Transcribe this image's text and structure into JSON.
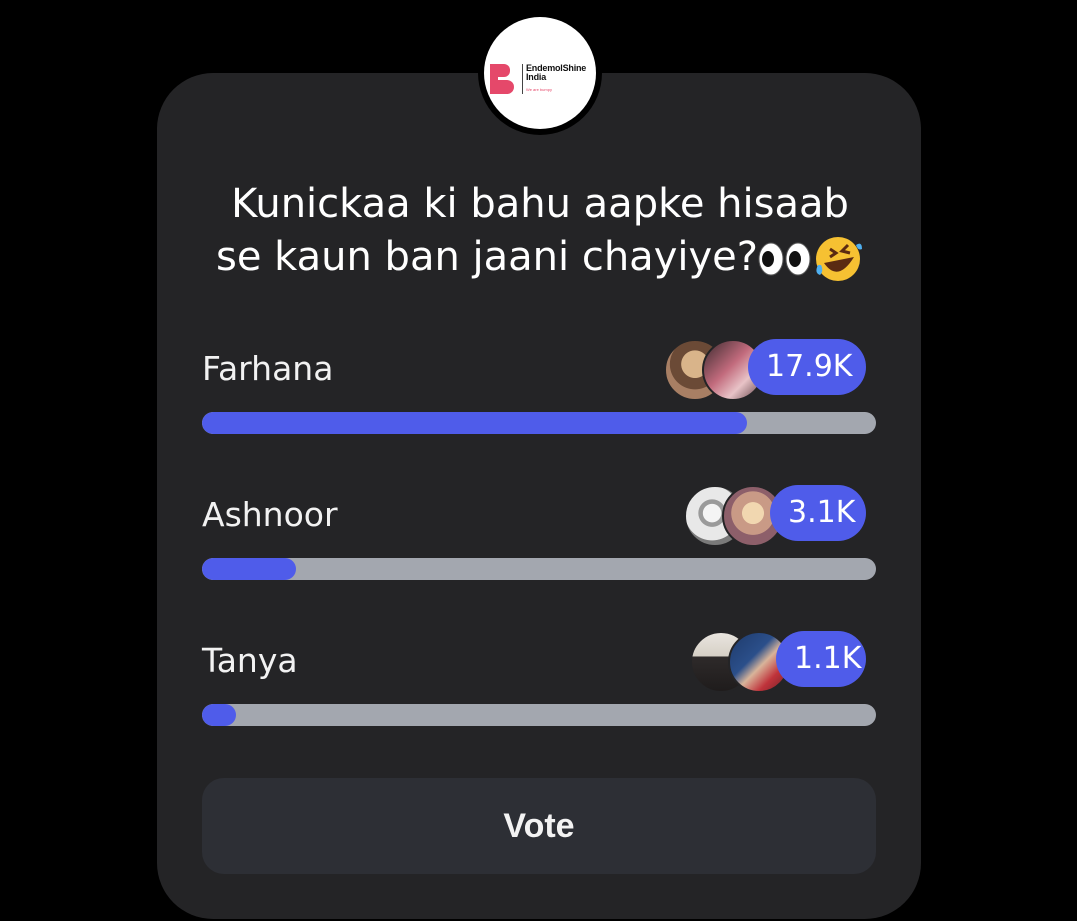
{
  "logo": {
    "line1": "EndemolShine",
    "line2": "India",
    "tagline": "We are bumpy",
    "brand_color": "#e5486a"
  },
  "poll": {
    "question_line1": "Kunickaa ki bahu aapke hisaab",
    "question_line2": "se kaun ban jaani chayiye?",
    "emojis": [
      "eyes-emoji",
      "rofl-emoji"
    ],
    "accent_color": "#4f5cea",
    "track_color": "#a3a7af",
    "options": [
      {
        "label": "Farhana",
        "count": "17.9K",
        "share": 0.809
      },
      {
        "label": "Ashnoor",
        "count": "3.1K",
        "share": 0.14
      },
      {
        "label": "Tanya",
        "count": "1.1K",
        "share": 0.05
      }
    ],
    "vote_label": "Vote"
  }
}
